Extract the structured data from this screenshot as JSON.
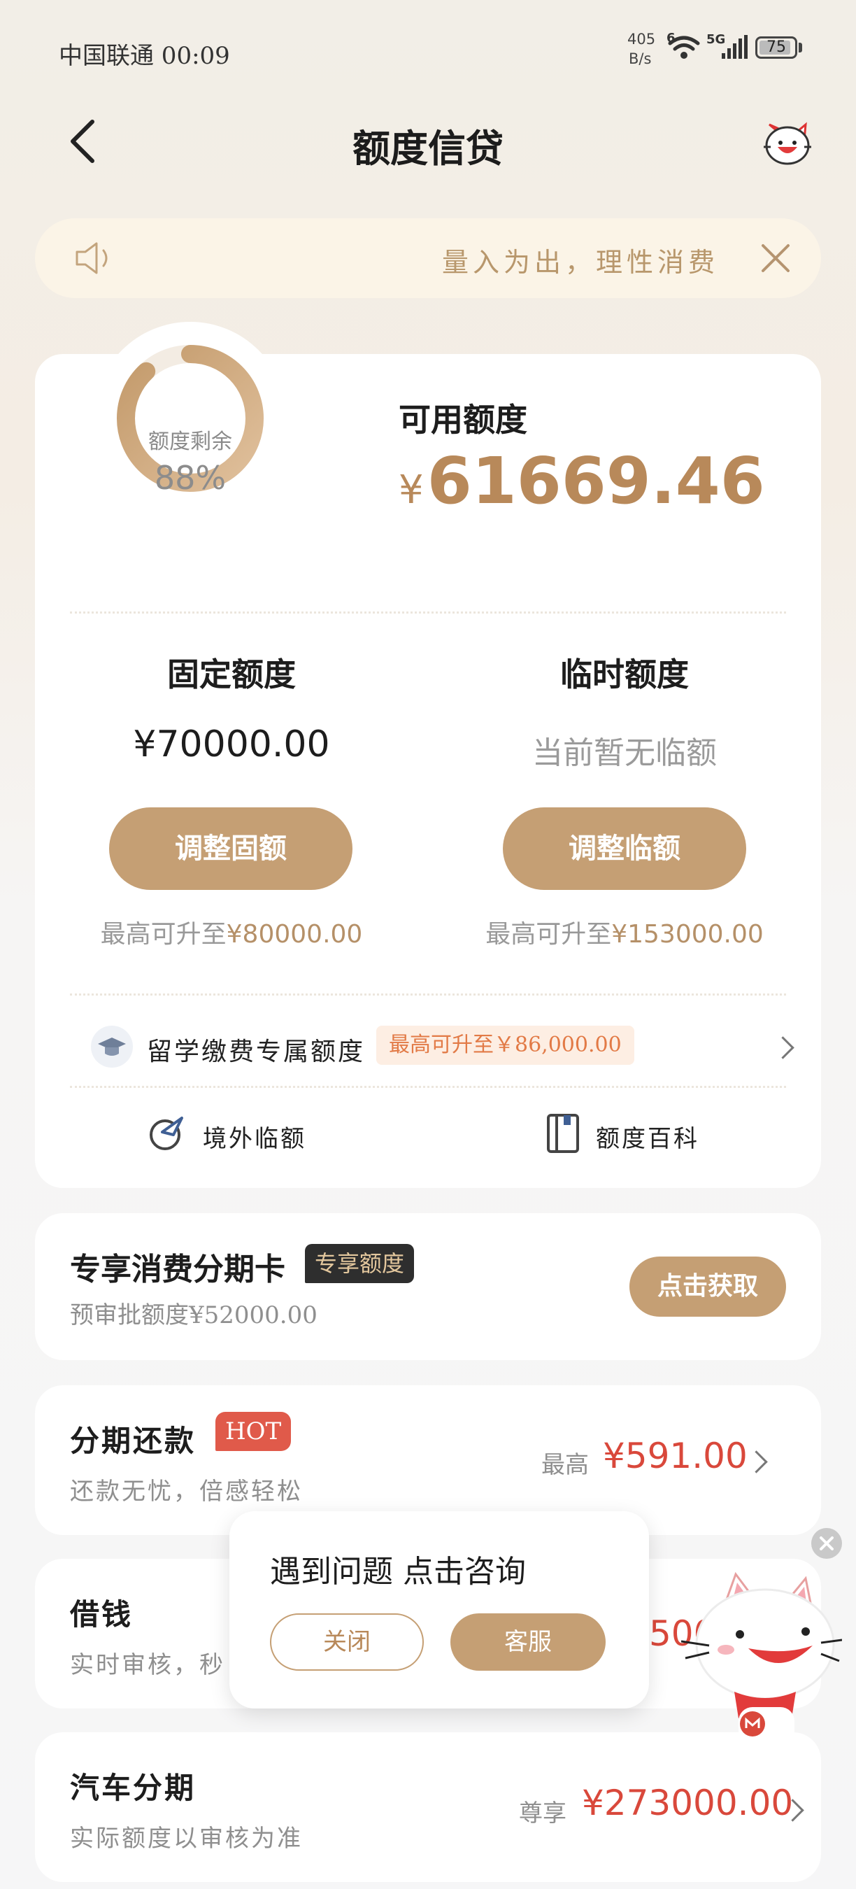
{
  "status_bar": {
    "carrier_time": "中国联通 00:09",
    "net_speed_value": "405",
    "net_speed_unit": "B/s",
    "wifi_badge": "6",
    "signal_badge": "5G",
    "battery": "75"
  },
  "header": {
    "title": "额度信贷"
  },
  "notice": {
    "text": "量入为出，理性消费"
  },
  "credit": {
    "ring_label": "额度剩余",
    "ring_percent": "88%",
    "remaining_fraction": 0.88,
    "available_label": "可用额度",
    "available_currency": "¥",
    "available_amount": "61669.46",
    "fixed": {
      "title": "固定额度",
      "amount": "¥70000.00",
      "button": "调整固额",
      "max_prefix": "最高可升至",
      "max_amount": "¥80000.00"
    },
    "temp": {
      "title": "临时额度",
      "amount": "当前暂无临额",
      "button": "调整临额",
      "max_prefix": "最高可升至",
      "max_amount": "¥153000.00"
    },
    "study": {
      "label": "留学缴费专属额度",
      "badge": "最高可升至￥86,000.00"
    },
    "links": [
      {
        "label": "境外临额"
      },
      {
        "label": "额度百科"
      }
    ]
  },
  "installment_card": {
    "title": "专享消费分期卡",
    "tag": "专享额度",
    "subtitle": "预审批额度¥52000.00",
    "button": "点击获取"
  },
  "products": [
    {
      "title": "分期还款",
      "badge": "HOT",
      "subtitle": "还款无忧，倍感轻松",
      "amount_prefix": "最高",
      "amount": "¥591.00"
    },
    {
      "title": "借钱",
      "subtitle": "实时审核，秒",
      "amount_partial": "500"
    },
    {
      "title": "汽车分期",
      "subtitle": "实际额度以审核为准",
      "amount_prefix": "尊享",
      "amount": "¥273000.00"
    }
  ],
  "popup": {
    "text": "遇到问题 点击咨询",
    "close_button": "关闭",
    "service_button": "客服"
  },
  "colors": {
    "gold": "#c59f74",
    "gold_text": "#b58d5c",
    "red": "#d9483b",
    "hot": "#e05a4a"
  }
}
